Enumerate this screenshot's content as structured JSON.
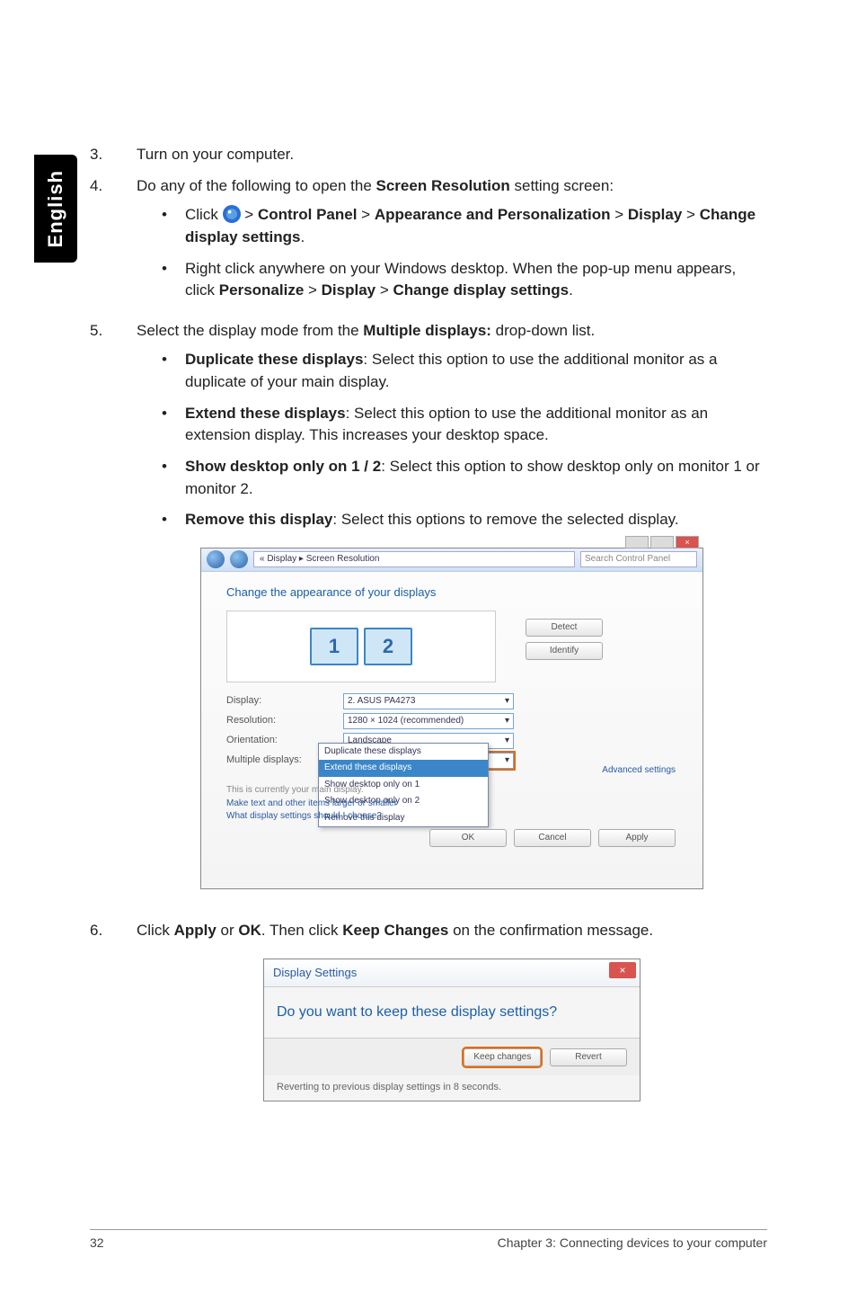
{
  "side_tab": "English",
  "steps": {
    "s3": {
      "num": "3.",
      "text": "Turn on your computer."
    },
    "s4": {
      "num": "4.",
      "lead_a": "Do any of the following to open the ",
      "lead_b": "Screen Resolution",
      "lead_c": " setting screen:",
      "b1": {
        "a": "Click ",
        "b": " > ",
        "c": "Control Panel",
        "d": " > ",
        "e": "Appearance and Personalization",
        "f": " > ",
        "g": "Display",
        "h": " > ",
        "i": "Change display settings",
        "j": "."
      },
      "b2": {
        "a": "Right click anywhere on your Windows desktop. When the pop-up menu appears, click ",
        "b": "Personalize",
        "c": " > ",
        "d": "Display",
        "e": " > ",
        "f": "Change display settings",
        "g": "."
      }
    },
    "s5": {
      "num": "5.",
      "lead_a": "Select the display mode from the ",
      "lead_b": "Multiple displays:",
      "lead_c": " drop-down list.",
      "i1": {
        "t": "Duplicate these displays",
        "r": ": Select this option to use the additional monitor as a duplicate of your main display."
      },
      "i2": {
        "t": "Extend these displays",
        "r": ": Select this option to use the additional monitor as an extension display. This increases your desktop space."
      },
      "i3": {
        "t": "Show desktop only on 1 / 2",
        "r": ": Select this option to show desktop only on monitor 1 or monitor 2."
      },
      "i4": {
        "t": "Remove this display",
        "r": ": Select this options to remove the selected display."
      }
    },
    "s6": {
      "num": "6.",
      "a": "Click ",
      "b": "Apply",
      "c": " or ",
      "d": "OK",
      "e": ". Then click ",
      "f": "Keep Changes",
      "g": " on the confirmation message."
    }
  },
  "ss1": {
    "breadcrumb": "« Display ▸ Screen Resolution",
    "search": "Search Control Panel",
    "heading": "Change the appearance of your displays",
    "mon1": "1",
    "mon2": "2",
    "btn_detect": "Detect",
    "btn_identify": "Identify",
    "lbl_display": "Display:",
    "lbl_resolution": "Resolution:",
    "lbl_orientation": "Orientation:",
    "lbl_multiple": "Multiple displays:",
    "val_display": "2. ASUS PA4273",
    "val_resolution": "1280 × 1024 (recommended)",
    "val_orientation": "Landscape",
    "val_multiple": "Duplicate these displays",
    "dd_opt1": "Duplicate these displays",
    "dd_opt2": "Extend these displays",
    "dd_opt3": "Show desktop only on 1",
    "dd_opt4": "Show desktop only on 2",
    "dd_opt5": "Remove this display",
    "note1": "This is currently your main display.",
    "note2": "Make text and other items larger or smaller",
    "note3": "What display settings should I choose?",
    "advanced": "Advanced settings",
    "ok": "OK",
    "cancel": "Cancel",
    "apply": "Apply"
  },
  "ss2": {
    "title": "Display Settings",
    "question": "Do you want to keep these display settings?",
    "keep": "Keep changes",
    "revert": "Revert",
    "footer": "Reverting to previous display settings in 8 seconds."
  },
  "footer": {
    "page": "32",
    "chapter": "Chapter 3: Connecting devices to your computer"
  }
}
